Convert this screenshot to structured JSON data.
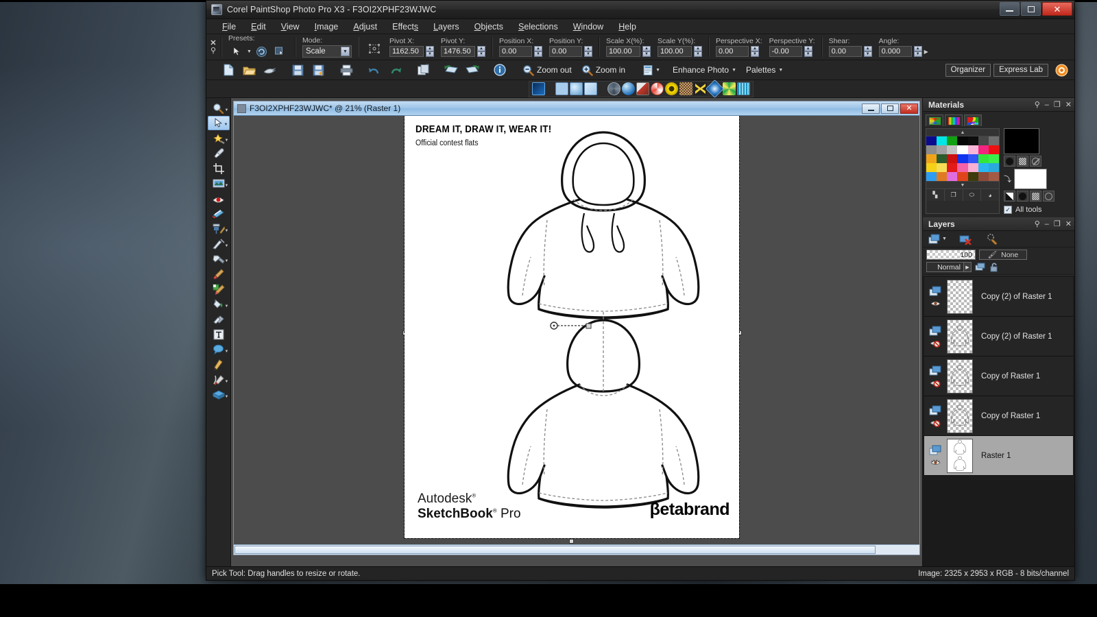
{
  "window": {
    "title": "Corel PaintShop Photo Pro X3 - F3OI2XPHF23WJWC",
    "minimize_label": "Minimize",
    "maximize_label": "Maximize",
    "close_label": "✕"
  },
  "menubar": {
    "items": [
      "File",
      "Edit",
      "View",
      "Image",
      "Adjust",
      "Effects",
      "Layers",
      "Objects",
      "Selections",
      "Window",
      "Help"
    ]
  },
  "options_bar": {
    "grip_close": "✕",
    "grip_pin": "⚲",
    "presets_label": "Presets:",
    "mode_label": "Mode:",
    "mode_value": "Scale",
    "pivot_x_label": "Pivot X:",
    "pivot_x_value": "1162.50",
    "pivot_y_label": "Pivot Y:",
    "pivot_y_value": "1476.50",
    "position_x_label": "Position X:",
    "position_x_value": "0.00",
    "position_y_label": "Position Y:",
    "position_y_value": "0.00",
    "scale_x_label": "Scale X(%):",
    "scale_x_value": "100.00",
    "scale_y_label": "Scale Y(%):",
    "scale_y_value": "100.00",
    "perspective_x_label": "Perspective X:",
    "perspective_x_value": "0.00",
    "perspective_y_label": "Perspective Y:",
    "perspective_y_value": "-0.00",
    "shear_label": "Shear:",
    "shear_value": "0.00",
    "angle_label": "Angle:",
    "angle_value": "0.000"
  },
  "main_toolbar": {
    "zoom_out": "Zoom out",
    "zoom_in": "Zoom in",
    "enhance_photo": "Enhance Photo",
    "palettes": "Palettes",
    "organizer": "Organizer",
    "express_lab": "Express Lab",
    "icons": [
      "new-icon",
      "open-icon",
      "browse-icon",
      "save-icon",
      "save-as-icon",
      "print-icon",
      "undo-icon",
      "redo-icon",
      "duplicate-icon",
      "rotate-left-icon",
      "rotate-right-icon",
      "info-icon",
      "zoom-out-icon",
      "zoom-in-icon",
      "fullscreen-icon"
    ]
  },
  "effects_toolbar": {
    "icons": [
      "selection-edit-icon",
      "fill-square-icon",
      "gradient-square-icon",
      "light-square-icon",
      "sphere-icon",
      "ball-icon",
      "brush-effect-icon",
      "candy-icon",
      "ring-icon",
      "texture-icon",
      "cutout-icon",
      "gem-icon",
      "sunburst-icon",
      "weave-icon"
    ]
  },
  "left_tools": {
    "items": [
      {
        "name": "zoom-tool",
        "has_dropdown": true,
        "selected": false
      },
      {
        "name": "pick-tool",
        "has_dropdown": true,
        "selected": true
      },
      {
        "name": "selection-tool",
        "has_dropdown": true,
        "selected": false
      },
      {
        "name": "dropper-tool",
        "has_dropdown": false,
        "selected": false
      },
      {
        "name": "crop-tool",
        "has_dropdown": false,
        "selected": false
      },
      {
        "name": "straighten-tool",
        "has_dropdown": true,
        "selected": false
      },
      {
        "name": "red-eye-tool",
        "has_dropdown": false,
        "selected": false
      },
      {
        "name": "makeover-tool",
        "has_dropdown": false,
        "selected": false
      },
      {
        "name": "clone-brush-tool",
        "has_dropdown": true,
        "selected": false
      },
      {
        "name": "scratch-remover-tool",
        "has_dropdown": true,
        "selected": false
      },
      {
        "name": "dodge-burn-tool",
        "has_dropdown": true,
        "selected": false
      },
      {
        "name": "paint-brush-tool",
        "has_dropdown": false,
        "selected": false
      },
      {
        "name": "art-media-tool",
        "has_dropdown": false,
        "selected": false
      },
      {
        "name": "flood-fill-tool",
        "has_dropdown": true,
        "selected": false
      },
      {
        "name": "eraser-tool",
        "has_dropdown": false,
        "selected": false
      },
      {
        "name": "text-tool",
        "has_dropdown": false,
        "selected": false
      },
      {
        "name": "shape-tool",
        "has_dropdown": true,
        "selected": false
      },
      {
        "name": "pen-tool",
        "has_dropdown": false,
        "selected": false
      },
      {
        "name": "warp-brush-tool",
        "has_dropdown": true,
        "selected": false
      },
      {
        "name": "object-tool",
        "has_dropdown": true,
        "selected": false
      }
    ]
  },
  "document": {
    "title": "F3OI2XPHF23WJWC* @  21% (Raster 1)",
    "minimize_label": "_",
    "restore_label": "❐",
    "close_label": "✕"
  },
  "canvas_art": {
    "headline": "DREAM IT, DRAW IT, WEAR IT!",
    "subhead": "Official contest flats",
    "brand_line1": "Autodesk",
    "brand_line2_bold": "SketchBook",
    "brand_line2_rest": "Pro",
    "brand_right": "βetabrand"
  },
  "materials_panel": {
    "title": "Materials",
    "tabs": [
      "frame-tab",
      "rainbow-tab",
      "swatches-tab"
    ],
    "active_tab_index": 2,
    "all_tools_label": "All tools",
    "all_tools_checked": true,
    "foreground_color": "#000000",
    "background_color": "#ffffff",
    "swatch_colors": [
      "#0a0a8e",
      "#00e5e5",
      "#11a011",
      "#070707",
      "#0d0d0d",
      "#474747",
      "#6e6e6e",
      "#8c8c8c",
      "#a0a0a0",
      "#c2c2c2",
      "#ffffff",
      "#f7b6d8",
      "#f2257f",
      "#ee1111",
      "#f0a41a",
      "#2b5c2b",
      "#cc1111",
      "#1133ee",
      "#3355f5",
      "#33e63a",
      "#3cef4a",
      "#f5d117",
      "#f5dd55",
      "#e21a1a",
      "#f562a8",
      "#f9b0d3",
      "#2ab6f0",
      "#2aa9dd",
      "#2e9df0",
      "#e07a22",
      "#e06de0",
      "#e0441a",
      "#3c3c0c",
      "#8c4a3a",
      "#a35a44"
    ]
  },
  "layers_panel": {
    "title": "Layers",
    "opacity_value": "100",
    "blend_mode": "Normal",
    "effect_value": "None",
    "toolbar_icons": [
      "new-raster-layer-icon",
      "delete-layer-icon",
      "layer-properties-icon"
    ],
    "layers": [
      {
        "name": "Copy (2) of Raster 1",
        "visible": true,
        "selected": false,
        "thumb": "faint"
      },
      {
        "name": "Copy (2) of Raster 1",
        "visible": false,
        "selected": false,
        "thumb": "front"
      },
      {
        "name": "Copy of Raster 1",
        "visible": false,
        "selected": false,
        "thumb": "front-top"
      },
      {
        "name": "Copy of Raster 1",
        "visible": false,
        "selected": false,
        "thumb": "back"
      },
      {
        "name": "Raster 1",
        "visible": true,
        "selected": true,
        "thumb": "full"
      }
    ]
  },
  "status_bar": {
    "left_text": "Pick Tool: Drag handles to resize or rotate.",
    "right_text": "Image:  2325 x 2953 x RGB - 8 bits/channel"
  }
}
